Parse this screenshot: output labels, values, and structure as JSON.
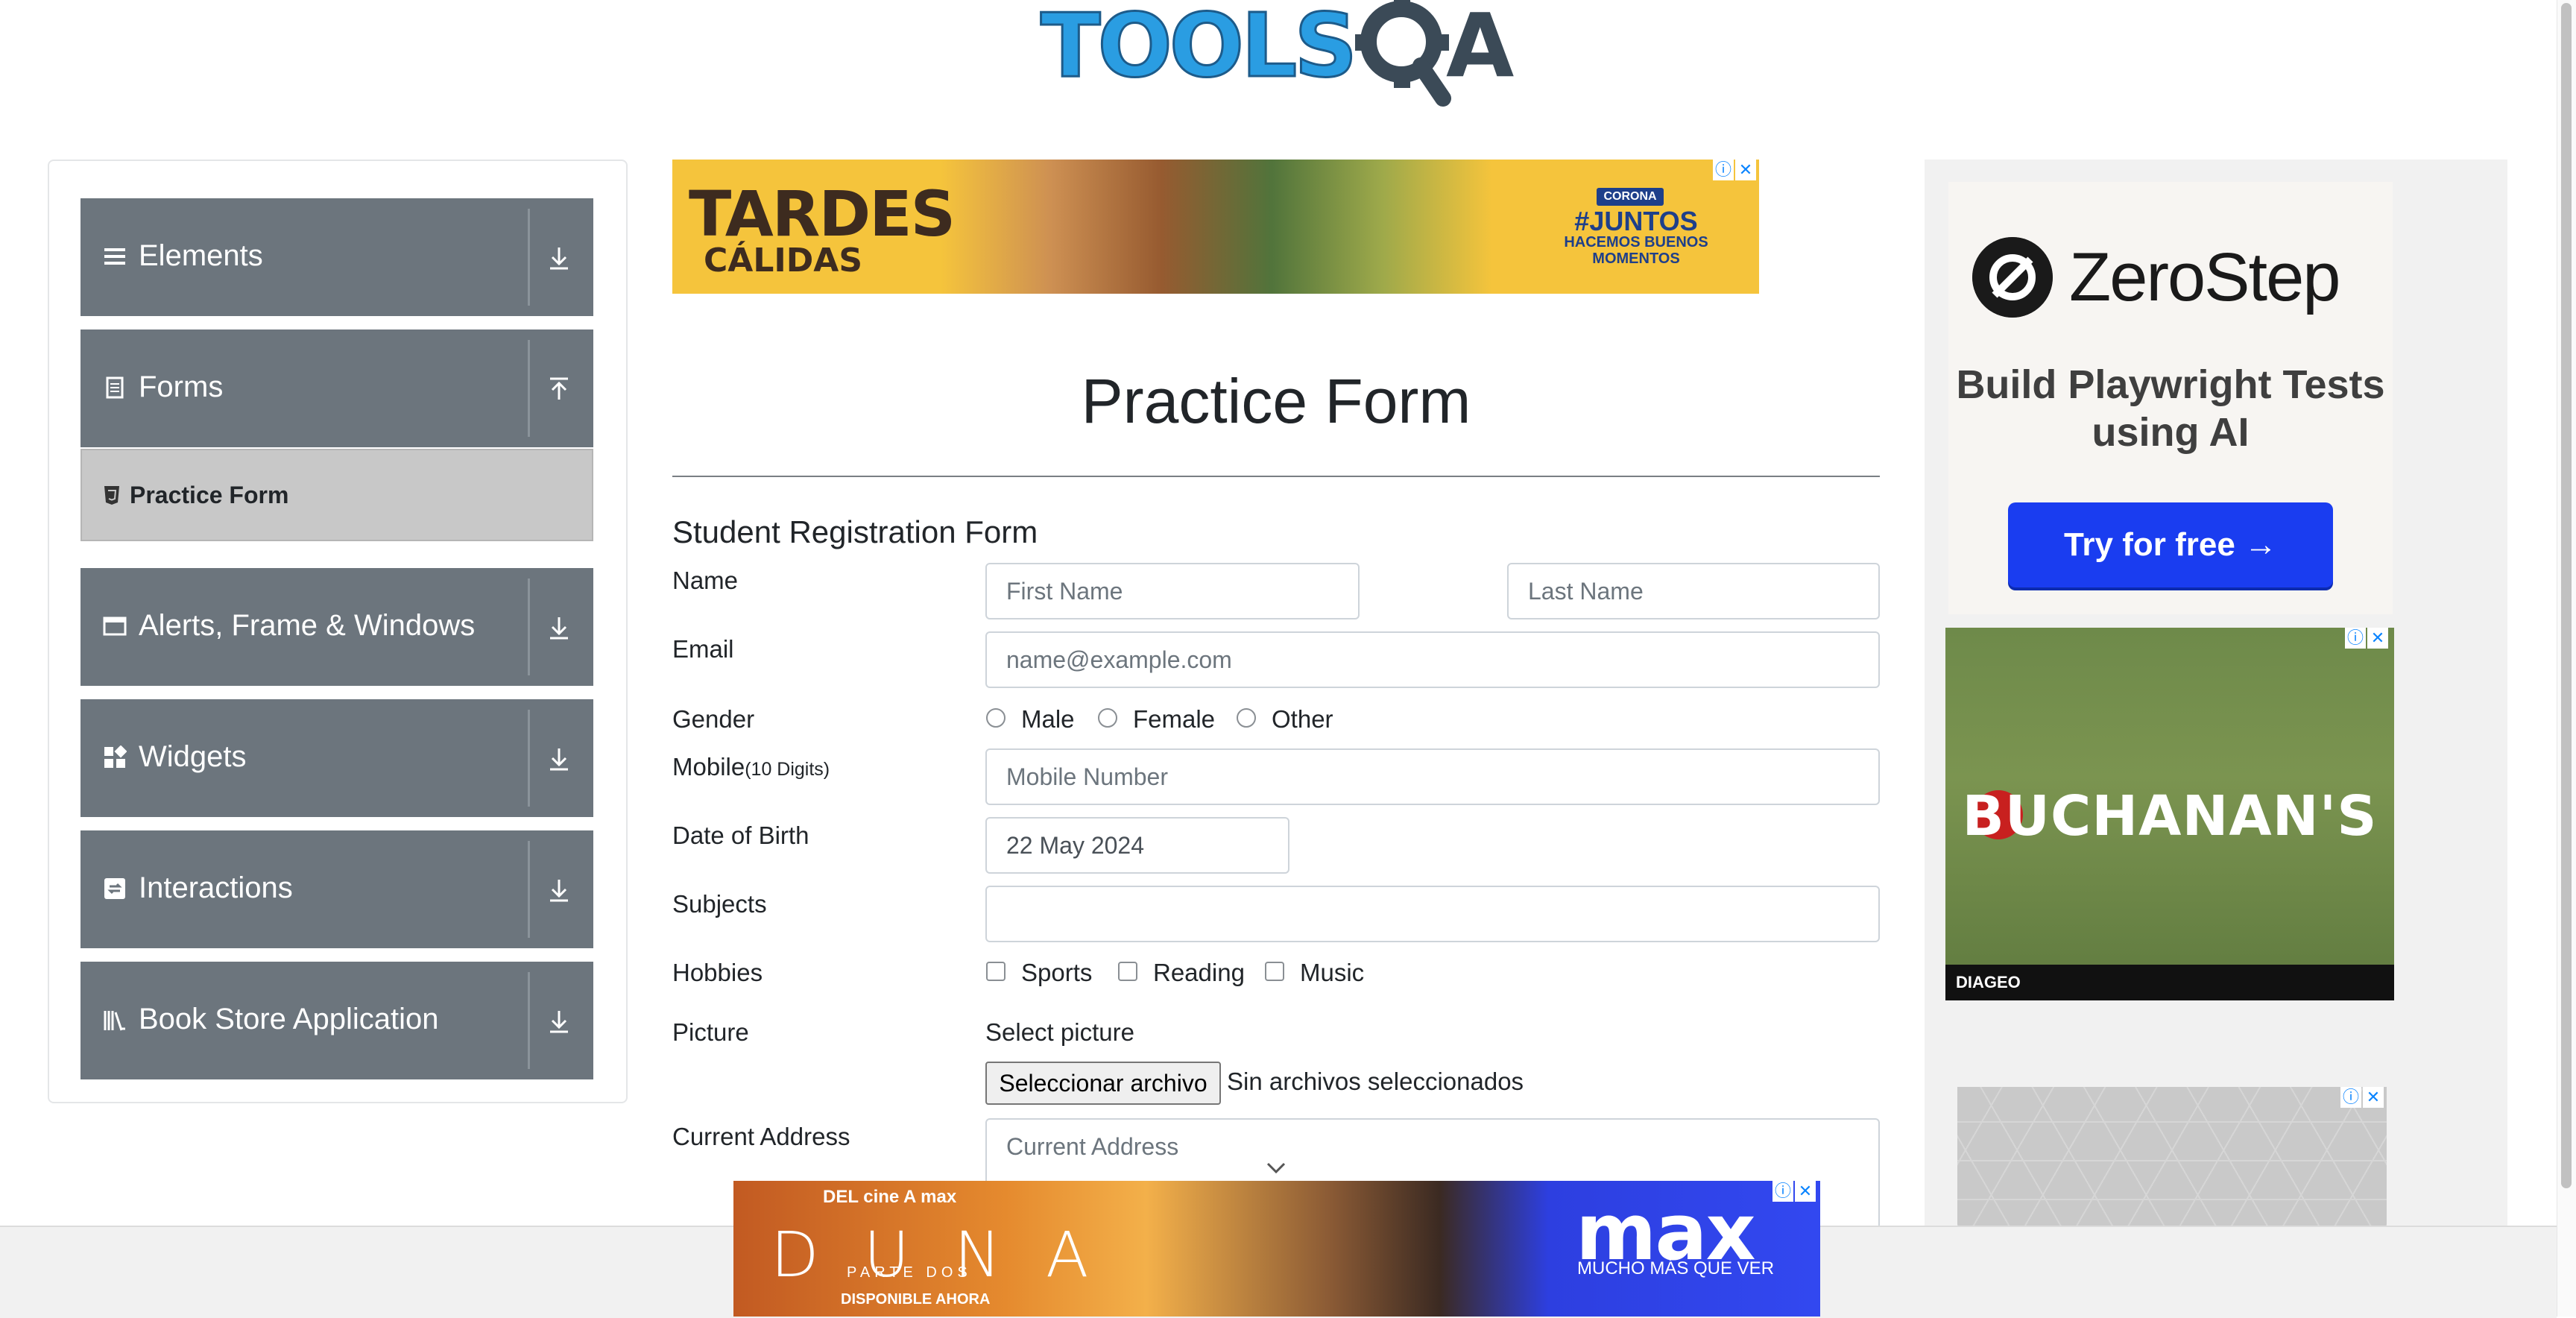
{
  "header": {
    "logo_text": "TOOLSQA"
  },
  "sidebar": {
    "groups": [
      {
        "label": "Elements",
        "icon": "hamburger-icon",
        "state": "collapsed"
      },
      {
        "label": "Forms",
        "icon": "document-icon",
        "state": "expanded"
      },
      {
        "label": "Alerts, Frame & Windows",
        "icon": "window-icon",
        "state": "collapsed"
      },
      {
        "label": "Widgets",
        "icon": "widgets-icon",
        "state": "collapsed"
      },
      {
        "label": "Interactions",
        "icon": "interactions-icon",
        "state": "collapsed"
      },
      {
        "label": "Book Store Application",
        "icon": "books-icon",
        "state": "collapsed"
      }
    ],
    "active_item": {
      "label": "Practice Form",
      "icon": "html5-icon"
    }
  },
  "ads": {
    "top": {
      "line1": "TARDES",
      "line2": "CÁLIDAS",
      "brand": "CORONA",
      "hashtag": "#JUNTOS",
      "hashtag_sub": "HACEMOS BUENOS MOMENTOS"
    },
    "right_zerostep": {
      "title": "ZeroStep",
      "subtitle": "Build Playwright Tests using AI",
      "cta": "Try for free →"
    },
    "right_buchanans": {
      "brand": "BUCHANAN'S",
      "footer": "DIAGEO"
    },
    "bottom": {
      "tagline": "DEL cine A max",
      "title": "DUNA",
      "subtitle": "PARTE DOS",
      "availability": "DISPONIBLE AHORA",
      "brand": "max",
      "brand_tagline": "MUCHO MÁS QUE VER"
    }
  },
  "page": {
    "title": "Practice Form",
    "form_heading": "Student Registration Form"
  },
  "form": {
    "name": {
      "label": "Name",
      "first_placeholder": "First Name",
      "last_placeholder": "Last Name"
    },
    "email": {
      "label": "Email",
      "placeholder": "name@example.com"
    },
    "gender": {
      "label": "Gender",
      "options": [
        "Male",
        "Female",
        "Other"
      ]
    },
    "mobile": {
      "label": "Mobile",
      "label_suffix": "(10 Digits)",
      "placeholder": "Mobile Number"
    },
    "dob": {
      "label": "Date of Birth",
      "value": "22 May 2024"
    },
    "subjects": {
      "label": "Subjects",
      "value": ""
    },
    "hobbies": {
      "label": "Hobbies",
      "options": [
        "Sports",
        "Reading",
        "Music"
      ]
    },
    "picture": {
      "label": "Picture",
      "prompt": "Select picture",
      "button": "Seleccionar archivo",
      "status": "Sin archivos seleccionados"
    },
    "address": {
      "label": "Current Address",
      "placeholder": "Current Address"
    }
  }
}
